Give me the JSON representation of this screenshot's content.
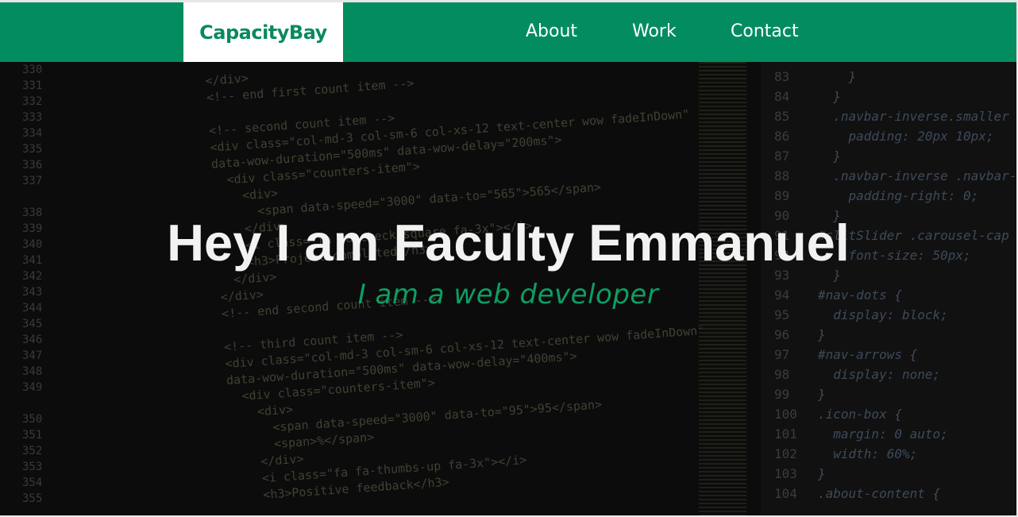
{
  "nav": {
    "brand": "CapacityBay",
    "links": [
      "About",
      "Work",
      "Contact"
    ]
  },
  "hero": {
    "title": "Hey I am Faculty Emmanuel",
    "subtitle": "I am a web developer"
  },
  "background_code": {
    "left_line_numbers": "330\n331\n332\n333\n334\n335\n336\n337\n\n338\n339\n340\n341\n342\n343\n344\n345\n346\n347\n348\n349\n\n350\n351\n352\n353\n354\n355",
    "left_code": "</div>\n<!-- end first count item -->\n\n<!-- second count item -->\n<div class=\"col-md-3 col-sm-6 col-xs-12 text-center wow fadeInDown\"\ndata-wow-duration=\"500ms\" data-wow-delay=\"200ms\">\n  <div class=\"counters-item\">\n    <div>\n      <span data-speed=\"3000\" data-to=\"565\">565</span>\n    </div>\n    <i class=\"fa fa-check-square fa-3x\"></i>\n    <h3>Project completed</h3>\n  </div>\n</div>\n<!-- end second count item -->\n\n<!-- third count item -->\n<div class=\"col-md-3 col-sm-6 col-xs-12 text-center wow fadeInDown\"\ndata-wow-duration=\"500ms\" data-wow-delay=\"400ms\">\n  <div class=\"counters-item\">\n    <div>\n      <span data-speed=\"3000\" data-to=\"95\">95</span>\n      <span>%</span>\n    </div>\n    <i class=\"fa fa-thumbs-up fa-3x\"></i>\n    <h3>Positive feedback</h3>",
    "right_line_numbers": "83\n84\n85\n86\n87\n88\n89\n90\n91\n92\n93\n94\n95\n96\n97\n98\n99\n100\n101\n102\n103\n104",
    "right_code": "    }\n  }\n  .navbar-inverse.smaller {\n    padding: 20px 10px;\n  }\n  .navbar-inverse .navbar-\n    padding-right: 0;\n  }\n#slitSlider .carousel-cap\n    font-size: 50px;\n  }\n#nav-dots {\n  display: block;\n}\n#nav-arrows {\n  display: none;\n}\n.icon-box {\n  margin: 0 auto;\n  width: 60%;\n}\n.about-content {"
  }
}
